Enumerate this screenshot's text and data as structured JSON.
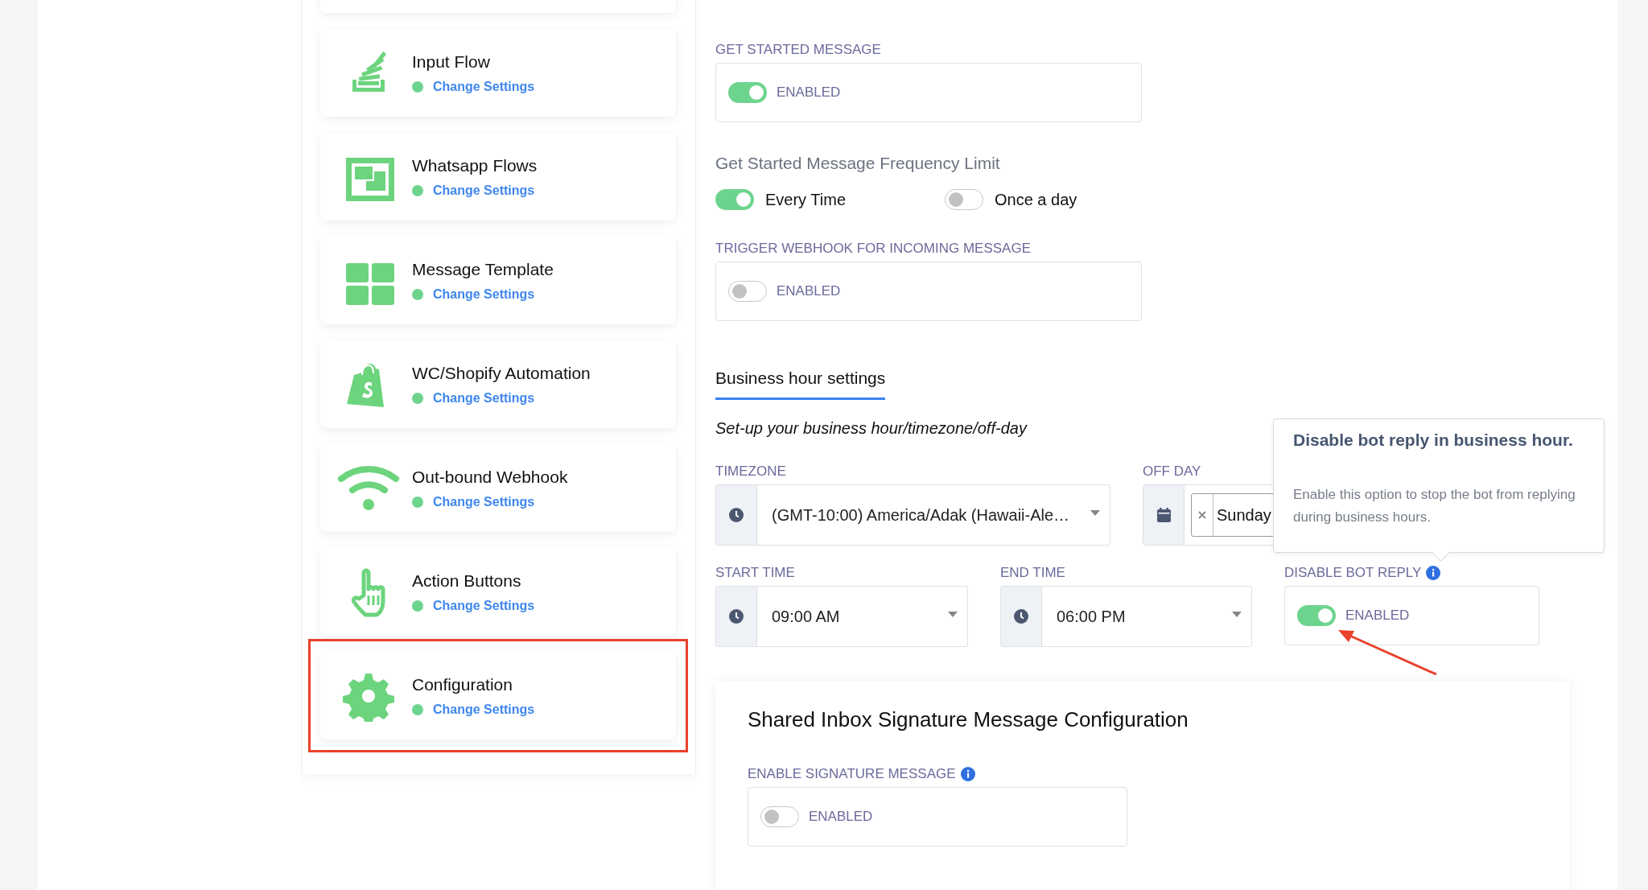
{
  "sidebar": {
    "items": [
      {
        "title": "Input Flow",
        "kind": "stack",
        "status": "Change Settings",
        "highlighted": false
      },
      {
        "title": "Whatsapp Flows",
        "kind": "frame",
        "status": "Change Settings",
        "highlighted": false
      },
      {
        "title": "Message Template",
        "kind": "grid",
        "status": "Change Settings",
        "highlighted": false
      },
      {
        "title": "WC/Shopify Automation",
        "kind": "bag",
        "status": "Change Settings",
        "highlighted": false
      },
      {
        "title": "Out-bound Webhook",
        "kind": "wifi",
        "status": "Change Settings",
        "highlighted": false
      },
      {
        "title": "Action Buttons",
        "kind": "hand",
        "status": "Change Settings",
        "highlighted": false
      },
      {
        "title": "Configuration",
        "kind": "gear",
        "status": "Change Settings",
        "highlighted": true
      }
    ]
  },
  "get_started_message": {
    "label": "GET STARTED MESSAGE",
    "on": true,
    "toggle_label": "ENABLED"
  },
  "frequency_limit": {
    "title": "Get Started Message Frequency Limit",
    "options": [
      {
        "label": "Every Time",
        "selected": true
      },
      {
        "label": "Once a day",
        "selected": false
      }
    ]
  },
  "trigger_webhook": {
    "label": "TRIGGER WEBHOOK FOR INCOMING MESSAGE",
    "on": false,
    "toggle_label": "ENABLED"
  },
  "business_hours": {
    "tab": "Business hour settings",
    "subtitle": "Set-up your business hour/timezone/off-day",
    "timezone": {
      "label": "TIMEZONE",
      "value": "(GMT-10:00) America/Adak (Hawaii-Ale…"
    },
    "off_day": {
      "label": "OFF DAY",
      "value": "Sunday"
    },
    "start_time": {
      "label": "START TIME",
      "value": "09:00 AM"
    },
    "end_time": {
      "label": "END TIME",
      "value": "06:00 PM"
    },
    "disable_bot_reply": {
      "label": "DISABLE BOT REPLY",
      "on": true,
      "toggle_label": "ENABLED"
    },
    "tooltip": {
      "title": "Disable bot reply in business hour.",
      "text": "Enable this option to stop the bot from replying during business hours."
    }
  },
  "signature": {
    "title": "Shared Inbox Signature Message Configuration",
    "label": "ENABLE SIGNATURE MESSAGE",
    "on": false,
    "toggle_label": "ENABLED"
  }
}
